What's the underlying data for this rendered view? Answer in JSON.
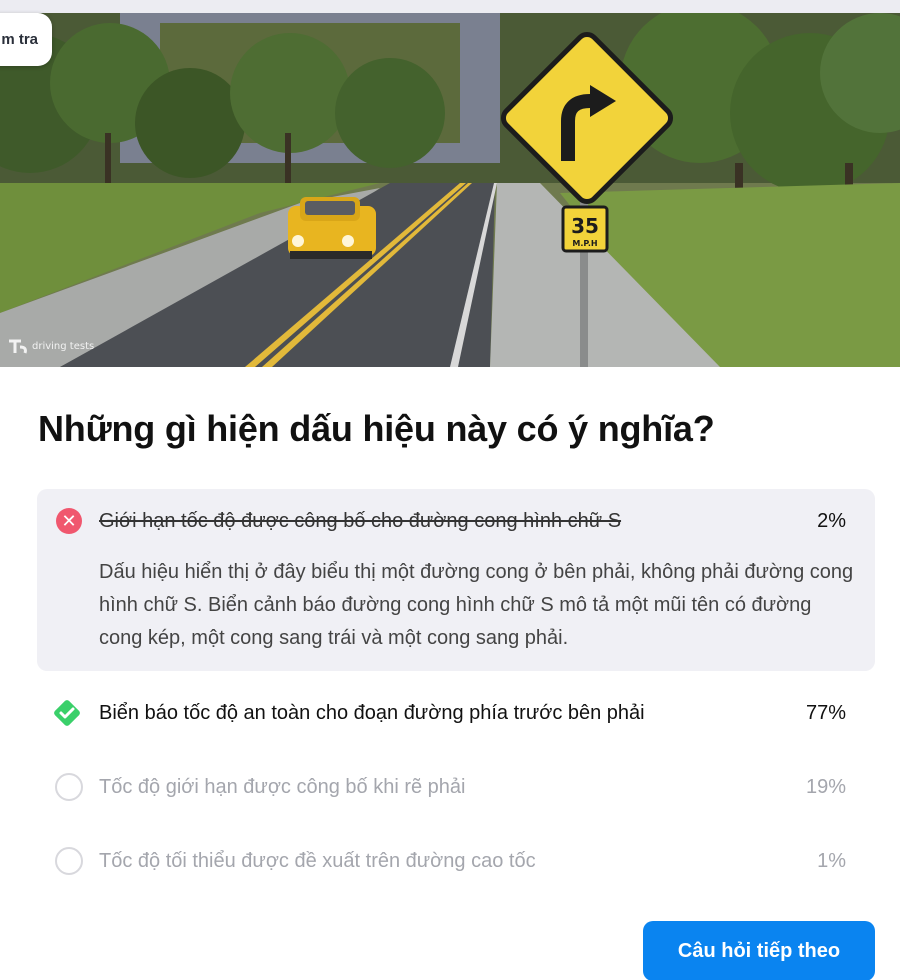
{
  "header": {
    "exam_label": "m tra"
  },
  "image": {
    "sign_speed": "35",
    "sign_unit": "M.P.H",
    "watermark": "driving tests"
  },
  "question": {
    "text": "Những gì hiện dấu hiệu này có ý nghĩa?"
  },
  "answers": [
    {
      "text": "Giới hạn tốc độ được công bố cho đường cong hình chữ S",
      "percent": "2%",
      "state": "wrong",
      "explanation": "Dấu hiệu hiển thị ở đây biểu thị một đường cong ở bên phải, không phải đường cong hình chữ S. Biển cảnh báo đường cong hình chữ S mô tả một mũi tên có đường cong kép, một cong sang trái và một cong sang phải."
    },
    {
      "text": "Biển báo tốc độ an toàn cho đoạn đường phía trước bên phải",
      "percent": "77%",
      "state": "correct"
    },
    {
      "text": "Tốc độ giới hạn được công bố khi rẽ phải",
      "percent": "19%",
      "state": "unselected"
    },
    {
      "text": "Tốc độ tối thiểu được đề xuất trên đường cao tốc",
      "percent": "1%",
      "state": "unselected"
    }
  ],
  "footer": {
    "next_label": "Câu hỏi tiếp theo"
  },
  "colors": {
    "accent": "#0a84f0",
    "wrong": "#f0576e",
    "correct": "#3ad06a"
  }
}
